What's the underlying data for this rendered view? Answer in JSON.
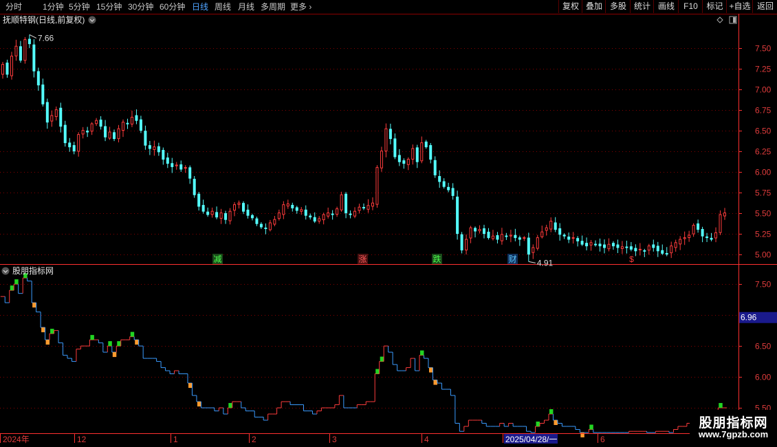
{
  "toolbar": {
    "periods": [
      "分时",
      "1分钟",
      "5分钟",
      "15分钟",
      "30分钟",
      "60分钟",
      "日线",
      "周线",
      "月线",
      "多周期",
      "更多"
    ],
    "active": "日线",
    "buttons": [
      "复权",
      "叠加",
      "多股",
      "统计",
      "画线",
      "F10",
      "标记",
      "+自选",
      "返回"
    ]
  },
  "main_panel": {
    "title": "抚顺特钢(日线,前复权)",
    "high_label": "7.66",
    "low_label": "4.91",
    "markers": [
      "减",
      "涨",
      "跌",
      "财",
      "$"
    ]
  },
  "indicator_panel": {
    "title": "股朋指标网",
    "value_box": "6.96"
  },
  "x_axis_labels": [
    "2024年",
    "12",
    "1",
    "2",
    "3",
    "4",
    "2025/04/28/一",
    "6"
  ],
  "watermark": {
    "title": "股朋指标网",
    "url": "www.7gpzb.com"
  },
  "colors": {
    "up": "#ff3c3c",
    "down": "#54ffff",
    "line_down": "#3a9bff",
    "grid": "#8b0000",
    "accent": "#ff3030"
  },
  "chart_data": [
    {
      "type": "candlestick",
      "title": "抚顺特钢(日线,前复权)",
      "ylim": [
        4.83,
        7.83
      ],
      "y_ticks": [
        5.0,
        5.25,
        5.5,
        5.75,
        6.0,
        6.25,
        6.5,
        6.75,
        7.0,
        7.25,
        7.5
      ],
      "high_point": 7.66,
      "low_point": 4.91,
      "close": [
        7.3,
        7.18,
        7.4,
        7.52,
        7.35,
        7.6,
        7.55,
        7.22,
        7.05,
        6.82,
        6.6,
        6.68,
        6.75,
        6.55,
        6.35,
        6.3,
        6.25,
        6.45,
        6.5,
        6.48,
        6.58,
        6.62,
        6.55,
        6.42,
        6.48,
        6.4,
        6.52,
        6.6,
        6.58,
        6.66,
        6.62,
        6.5,
        6.32,
        6.28,
        6.3,
        6.24,
        6.15,
        6.1,
        6.06,
        6.08,
        6.03,
        6.05,
        5.92,
        5.72,
        5.58,
        5.52,
        5.48,
        5.52,
        5.45,
        5.5,
        5.42,
        5.52,
        5.6,
        5.62,
        5.52,
        5.47,
        5.44,
        5.37,
        5.33,
        5.31,
        5.38,
        5.42,
        5.5,
        5.6,
        5.61,
        5.56,
        5.53,
        5.54,
        5.47,
        5.45,
        5.4,
        5.43,
        5.48,
        5.5,
        5.48,
        5.55,
        5.72,
        5.5,
        5.48,
        5.52,
        5.57,
        5.56,
        5.59,
        5.62,
        6.05,
        6.25,
        6.52,
        6.4,
        6.18,
        6.12,
        6.1,
        6.15,
        6.28,
        6.12,
        6.35,
        6.3,
        6.15,
        5.96,
        5.88,
        5.82,
        5.78,
        5.71,
        5.25,
        5.05,
        5.18,
        5.32,
        5.28,
        5.3,
        5.25,
        5.2,
        5.22,
        5.18,
        5.24,
        5.22,
        5.23,
        5.2,
        5.18,
        5.2,
        5.0,
        5.08,
        5.2,
        5.27,
        5.32,
        5.4,
        5.3,
        5.24,
        5.22,
        5.18,
        5.2,
        5.16,
        5.12,
        5.1,
        5.14,
        5.12,
        5.1,
        5.08,
        5.12,
        5.1,
        5.08,
        5.09,
        5.08,
        5.06,
        5.04,
        5.06,
        5.04,
        5.1,
        5.08,
        5.04,
        5.01,
        5.0,
        5.1,
        5.14,
        5.18,
        5.2,
        5.23,
        5.35,
        5.3,
        5.22,
        5.2,
        5.18,
        5.26,
        5.48,
        5.5
      ],
      "series": [
        {
          "name": "",
          "values": []
        }
      ]
    },
    {
      "type": "step-line",
      "title": "股朋指标网",
      "ylim": [
        5.1,
        7.78
      ],
      "y_ticks": [
        5.5,
        6.0,
        6.5,
        7.0,
        7.5
      ],
      "value_box": 6.96
    }
  ]
}
